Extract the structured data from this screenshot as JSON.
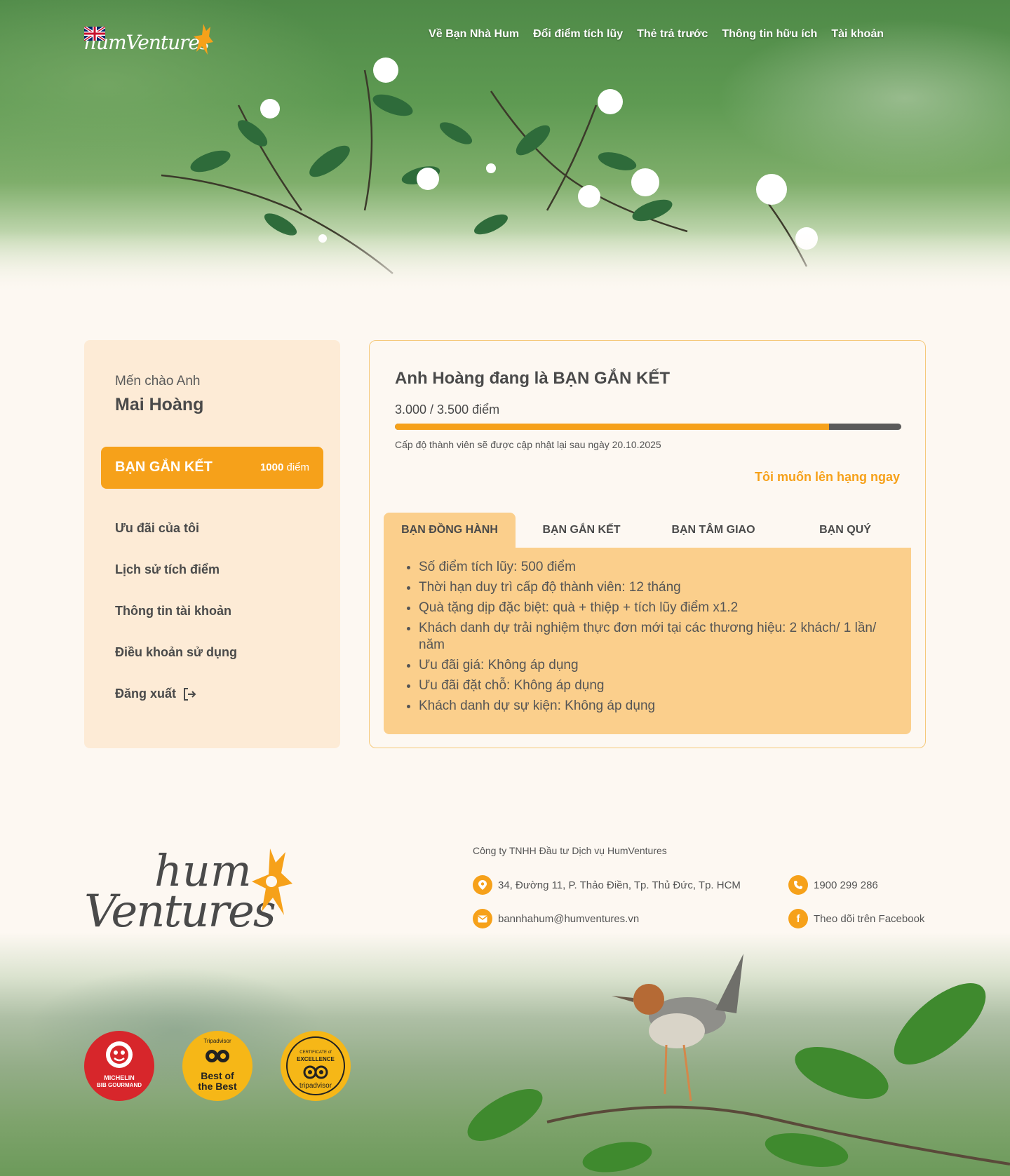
{
  "nav": {
    "logo_text": "humVentures",
    "links": [
      "Về Bạn Nhà Hum",
      "Đổi điểm tích lũy",
      "Thẻ trả trước",
      "Thông tin hữu ích",
      "Tài khoản"
    ]
  },
  "sidebar": {
    "greeting": "Mến chào Anh",
    "name": "Mai Hoàng",
    "tier_label": "BẠN GẮN KẾT",
    "tier_points": "1000",
    "tier_points_unit": "điểm",
    "menu": [
      "Ưu đãi của tôi",
      "Lịch sử tích điểm",
      "Thông tin tài khoản",
      "Điều khoản sử dụng",
      "Đăng xuất"
    ]
  },
  "panel": {
    "status_title": "Anh Hoàng đang là BẠN GẮN KẾT",
    "points_text": "3.000 / 3.500 điểm",
    "progress": 0.857,
    "note": "Cấp độ thành viên sẽ được cập nhật lại sau ngày 20.10.2025",
    "upgrade_link": "Tôi muốn lên hạng ngay",
    "tabs": [
      "BẠN ĐỒNG HÀNH",
      "BẠN GẮN KẾT",
      "BẠN TÂM GIAO",
      "BẠN QUÝ"
    ],
    "active_tab": 0,
    "benefits": [
      "Số điểm tích lũy: 500 điểm",
      "Thời hạn duy trì cấp độ thành viên: 12 tháng",
      "Quà tặng dịp đặc biệt: quà + thiệp + tích lũy điểm x1.2",
      "Khách danh dự trải nghiệm thực đơn mới tại các thương hiệu: 2 khách/ 1 lần/ năm",
      "Ưu đãi giá: Không áp dụng",
      "Ưu đãi đặt chỗ: Không áp dụng",
      "Khách danh dự sự kiện: Không áp dụng"
    ]
  },
  "footer": {
    "logo_line1": "hum",
    "logo_line2": "Ventures",
    "company": "Công ty TNHH Đầu tư Dịch vụ HumVentures",
    "address": "34, Đường 11, P. Thảo Điền,  Tp. Thủ Đức, Tp. HCM",
    "phone": "1900 299 286",
    "email": "bannhahum@humventures.vn",
    "facebook": "Theo dõi trên Facebook",
    "badges": {
      "michelin_line1": "MICHELIN",
      "michelin_line2": "BIB GOURMAND",
      "best_top": "Tripadvisor",
      "best_line1": "Best of",
      "best_line2": "the Best",
      "cert_line1": "CERTIFICATE of",
      "cert_line2": "EXCELLENCE",
      "cert_brand": "tripadvisor"
    }
  },
  "colors": {
    "accent": "#f6a11a",
    "sidebar_bg": "#fdebd6",
    "tab_bg": "#fbcf8c",
    "text": "#4a4a4a",
    "michelin": "#d7262b",
    "tripadvisor": "#f6b717"
  },
  "icons": [
    "flag-uk-icon",
    "logout-icon",
    "map-pin-icon",
    "phone-icon",
    "mail-icon",
    "facebook-icon"
  ]
}
